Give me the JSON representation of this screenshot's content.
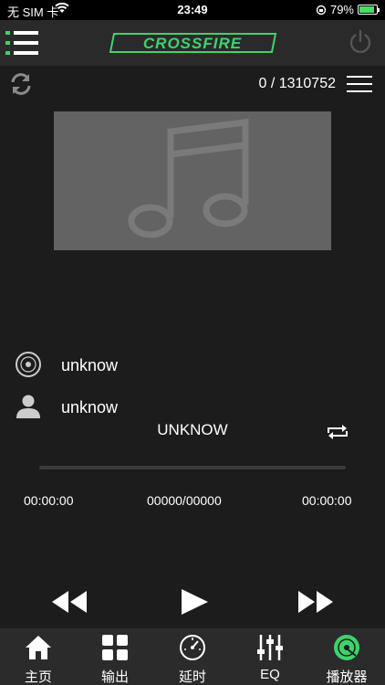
{
  "status": {
    "carrier": "无 SIM 卡",
    "time": "23:49",
    "battery": "79%"
  },
  "header": {
    "logo_text": "CROSSFIRE"
  },
  "player": {
    "counter": "0 / 1310752",
    "album": "unknow",
    "artist": "unknow",
    "title": "UNKNOW",
    "elapsed": "00:00:00",
    "track_position": "00000/00000",
    "duration": "00:00:00",
    "progress": 0
  },
  "tabs": [
    {
      "label": "主页",
      "icon": "home-icon"
    },
    {
      "label": "输出",
      "icon": "grid-icon"
    },
    {
      "label": "延时",
      "icon": "timer-icon"
    },
    {
      "label": "EQ",
      "icon": "equalizer-icon"
    },
    {
      "label": "播放器",
      "icon": "player-disc-icon"
    }
  ],
  "colors": {
    "accent": "#3fd36b",
    "background": "#1c1c1c",
    "bar": "#2b2b2b"
  }
}
